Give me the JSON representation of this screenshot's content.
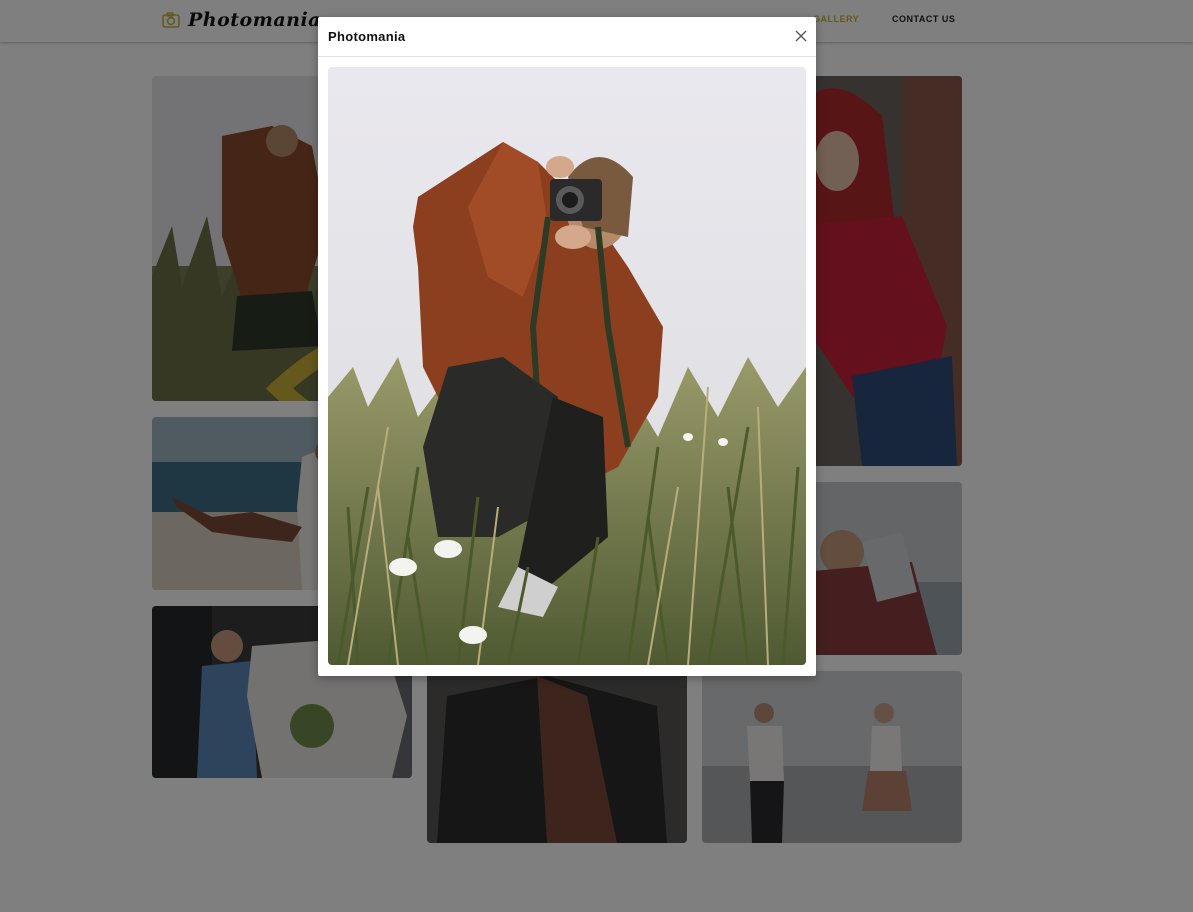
{
  "header": {
    "brand": "Photomania",
    "logo_icon": "camera-icon",
    "accent_color": "#c9b13b",
    "nav": {
      "gallery": "GALLERY",
      "contact": "CONTACT US"
    }
  },
  "gallery": {
    "hover_icon": "eye-icon",
    "items": [
      "woman-photographer-in-grass",
      "couple-on-beach",
      "man-hiding-flowers",
      "woman-in-graphic-tee",
      "woman-with-red-hair",
      "couple-hugging-by-sea",
      "couple-holding-hands-on-shore"
    ]
  },
  "modal": {
    "title": "Photomania",
    "close_icon": "close-icon",
    "image": "woman-photographer-in-grass"
  }
}
